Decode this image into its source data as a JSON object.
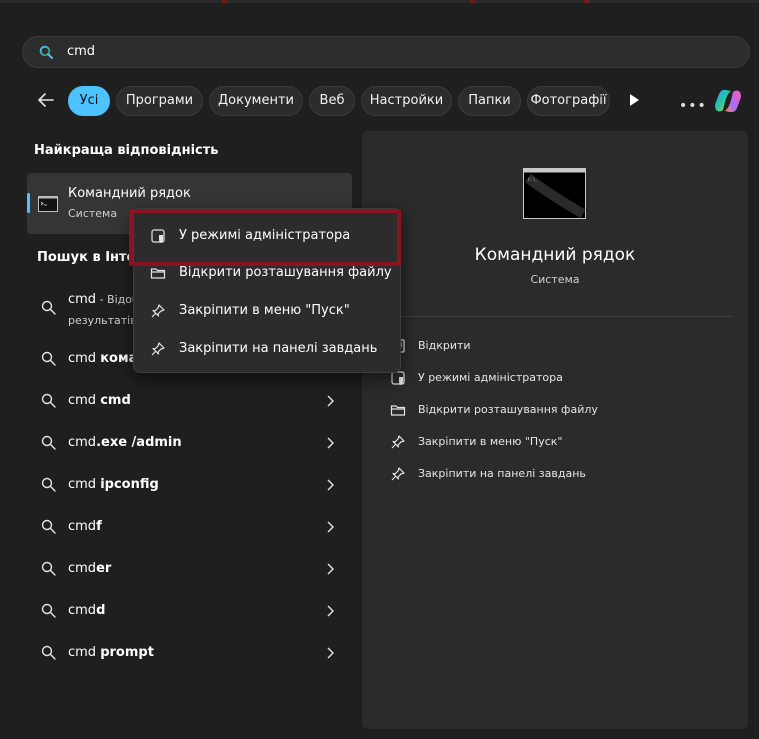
{
  "search": {
    "query": "cmd"
  },
  "filters": [
    {
      "label": "Усі",
      "active": true
    },
    {
      "label": "Програми"
    },
    {
      "label": "Документи"
    },
    {
      "label": "Веб"
    },
    {
      "label": "Настройки"
    },
    {
      "label": "Папки"
    },
    {
      "label": "Фотографії"
    }
  ],
  "more_label": "•••",
  "best_match": {
    "section_title": "Найкраща відповідність",
    "name": "Командний рядок",
    "type": "Система"
  },
  "web": {
    "section_title": "Пошук в Інтернеті",
    "results": [
      {
        "plain": "cmd",
        "bold": "",
        "extra": " - Відобразити результати пошуку",
        "sub": "результатів"
      },
      {
        "plain": "cmd ",
        "bold": "команди"
      },
      {
        "plain": "cmd ",
        "bold": "cmd"
      },
      {
        "plain": "cmd",
        "bold": ".exe /admin"
      },
      {
        "plain": "cmd ",
        "bold": "ipconfig"
      },
      {
        "plain": "cmd",
        "bold": "f"
      },
      {
        "plain": "cmd",
        "bold": "er"
      },
      {
        "plain": "cmd",
        "bold": "d"
      },
      {
        "plain": "cmd ",
        "bold": "prompt"
      }
    ]
  },
  "preview": {
    "name": "Командний рядок",
    "type": "Система",
    "actions": [
      {
        "label": "Відкрити",
        "icon": "open-icon"
      },
      {
        "label": "У режимі адміністратора",
        "icon": "admin-shield-icon"
      },
      {
        "label": "Відкрити розташування файлу",
        "icon": "folder-icon"
      },
      {
        "label": "Закріпити в меню \"Пуск\"",
        "icon": "pin-icon"
      },
      {
        "label": "Закріпити на панелі завдань",
        "icon": "pin-icon"
      }
    ]
  },
  "context_menu": {
    "items": [
      {
        "label": "У режимі адміністратора",
        "icon": "admin-shield-icon"
      },
      {
        "label": "Відкрити розташування файлу",
        "icon": "folder-icon"
      },
      {
        "label": "Закріпити в меню \"Пуск\"",
        "icon": "pin-icon"
      },
      {
        "label": "Закріпити на панелі завдань",
        "icon": "pin-icon"
      }
    ]
  },
  "colors": {
    "accent": "#4cc2ff",
    "highlight": "#8b1220",
    "background": "#1f1f1f",
    "panel": "#2b2b2b"
  }
}
